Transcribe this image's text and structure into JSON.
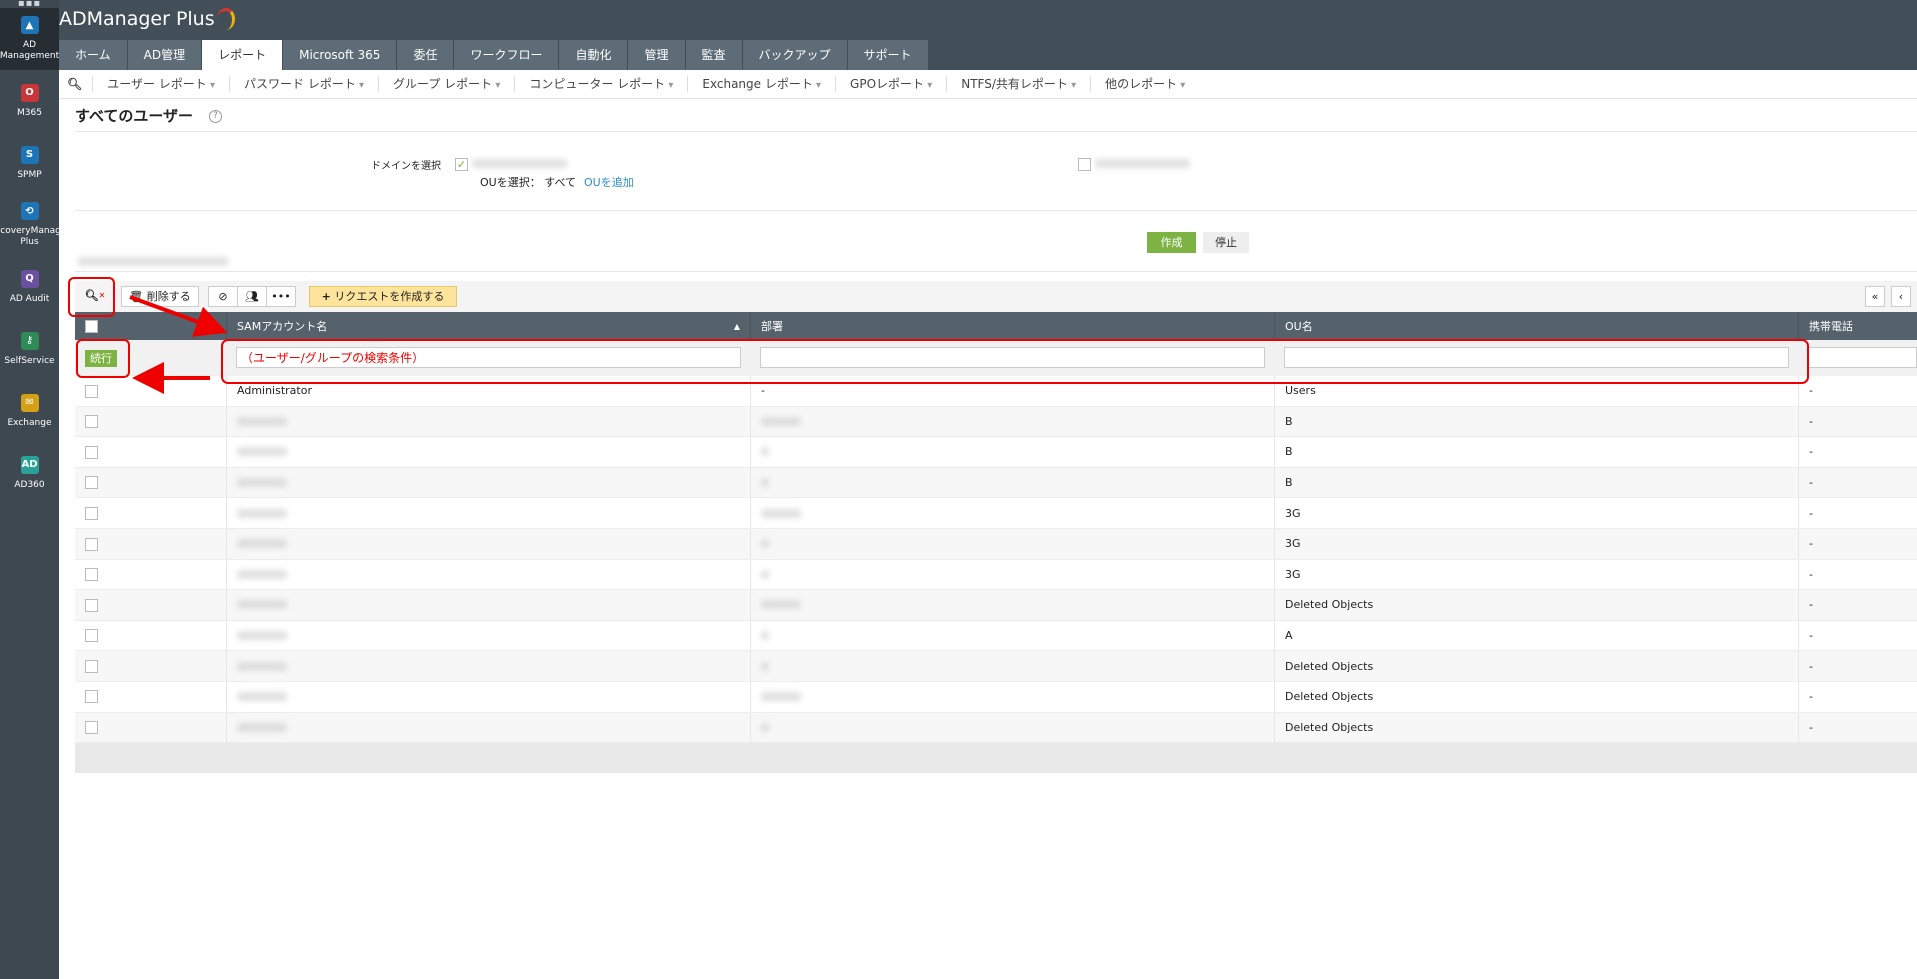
{
  "sidebar": {
    "items": [
      {
        "label": "AD Management",
        "color": "#1d75b8",
        "glyph": "▲"
      },
      {
        "label": "M365",
        "color": "#c8363a",
        "glyph": "O"
      },
      {
        "label": "SPMP",
        "color": "#1d75b8",
        "glyph": "S"
      },
      {
        "label": "RecoveryManager Plus",
        "color": "#1d75b8",
        "glyph": "⟲"
      },
      {
        "label": "AD Audit",
        "color": "#6b4fa0",
        "glyph": "Q"
      },
      {
        "label": "SelfService",
        "color": "#2e8b57",
        "glyph": "⚷"
      },
      {
        "label": "Exchange",
        "color": "#d4a017",
        "glyph": "✉"
      },
      {
        "label": "AD360",
        "color": "#2aa198",
        "glyph": "AD"
      }
    ]
  },
  "app": {
    "title": "ADManager Plus"
  },
  "tabs": [
    "ホーム",
    "AD管理",
    "レポート",
    "Microsoft 365",
    "委任",
    "ワークフロー",
    "自動化",
    "管理",
    "監査",
    "バックアップ",
    "サポート"
  ],
  "active_tab": "レポート",
  "subnav": [
    "ユーザー レポート",
    "パスワード レポート",
    "グループ レポート",
    "コンピューター レポート",
    "Exchange レポート",
    "GPOレポート",
    "NTFS/共有レポート",
    "他のレポート"
  ],
  "page": {
    "title": "すべてのユーザー",
    "domain_label": "ドメインを選択",
    "ou_label": "OUを選択：",
    "ou_value": "すべて",
    "ou_add": "OUを追加",
    "generate": "作成",
    "stop": "停止"
  },
  "toolbar": {
    "delete": "削除する",
    "more": "•••",
    "request": "リクエストを作成する",
    "first": "«",
    "prev": "‹"
  },
  "table": {
    "columns": [
      "SAMアカウント名",
      "部署",
      "OU名",
      "携帯電話"
    ],
    "go": "続行",
    "filter_placeholder": "（ユーザー/グループの検索条件）",
    "rows": [
      {
        "name": "Administrator",
        "dept": "-",
        "ou": "Users",
        "phone": "-"
      },
      {
        "name": "",
        "dept": "",
        "ou": "B",
        "phone": "-"
      },
      {
        "name": "",
        "dept": "",
        "ou": "B",
        "phone": "-"
      },
      {
        "name": "",
        "dept": "",
        "ou": "B",
        "phone": "-"
      },
      {
        "name": "",
        "dept": "",
        "ou": "3G",
        "phone": "-"
      },
      {
        "name": "",
        "dept": "",
        "ou": "3G",
        "phone": "-"
      },
      {
        "name": "",
        "dept": "",
        "ou": "3G",
        "phone": "-"
      },
      {
        "name": "",
        "dept": "",
        "ou": "Deleted Objects",
        "phone": "-"
      },
      {
        "name": "",
        "dept": "",
        "ou": "A",
        "phone": "-"
      },
      {
        "name": "",
        "dept": "",
        "ou": "Deleted Objects",
        "phone": "-"
      },
      {
        "name": "",
        "dept": "",
        "ou": "Deleted Objects",
        "phone": "-"
      },
      {
        "name": "",
        "dept": "",
        "ou": "Deleted Objects",
        "phone": "-"
      }
    ]
  },
  "colors": {
    "accent_green": "#7cb342",
    "header": "#434f58",
    "annotation": "#e00000"
  }
}
